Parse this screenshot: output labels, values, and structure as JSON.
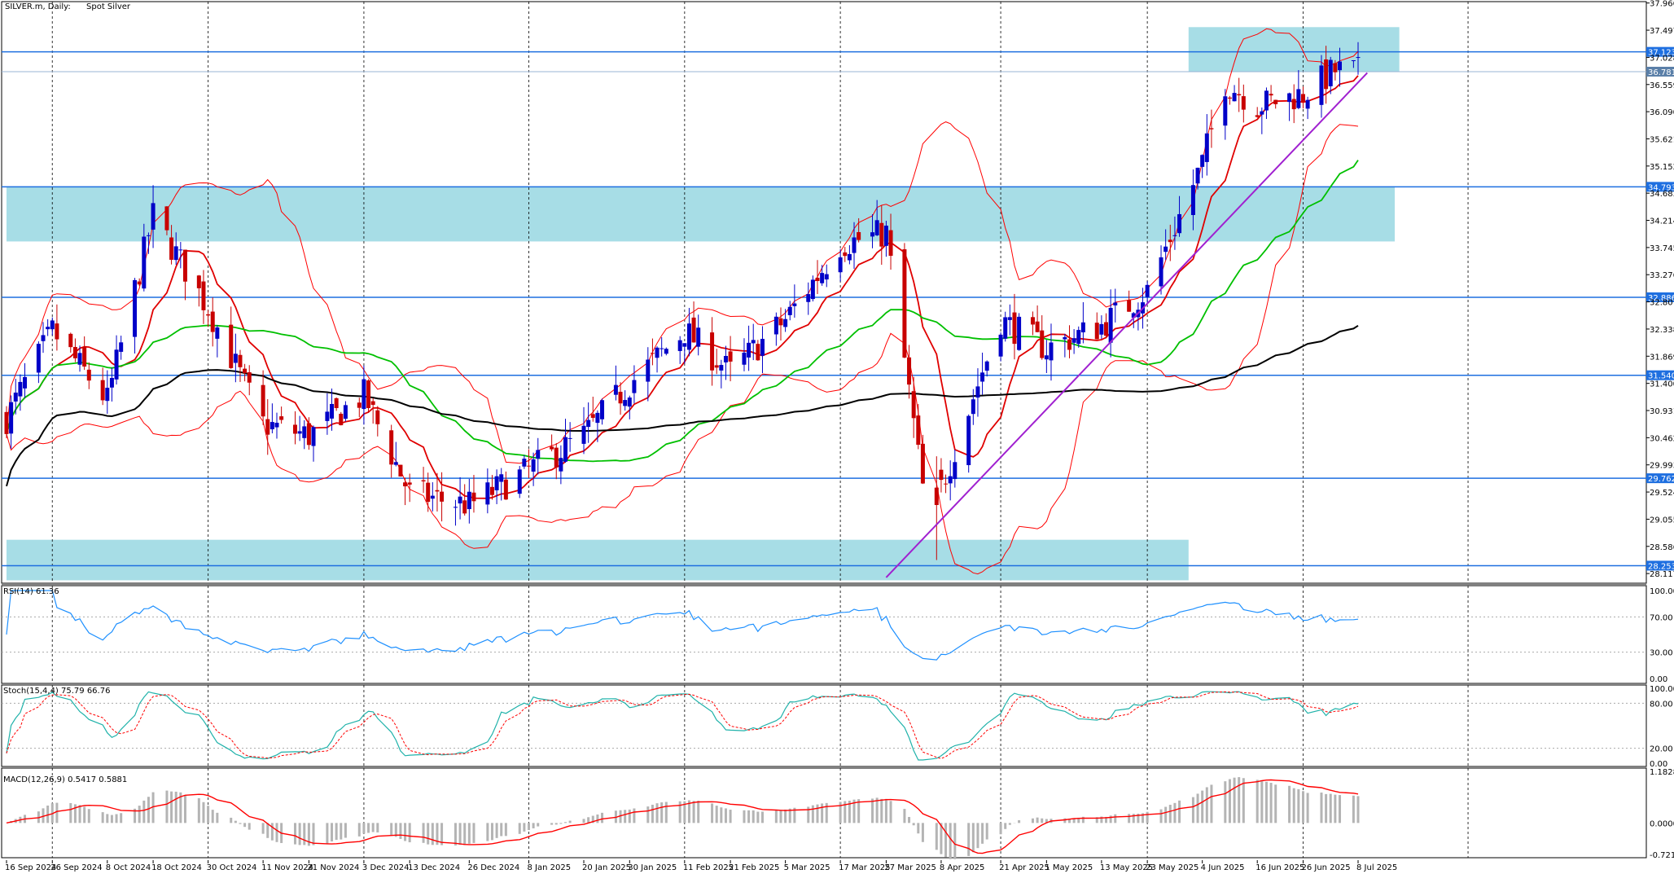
{
  "header": {
    "symbol": "SILVER.m, Daily:",
    "description": "Spot Silver"
  },
  "panels": {
    "rsi_title": "RSI(14) 61.36",
    "stoch_title": "Stoch(15,4,4) 75.79 66.76",
    "macd_title": "MACD(12,26,9) 0.5417 0.5881"
  },
  "colors": {
    "up_candle": "#0000c8",
    "down_candle": "#c80000",
    "zone_fill": "#a7dde6",
    "level_line": "#1e6fe0",
    "ma_fast": "#e00000",
    "ma_mid": "#00c000",
    "ma_slow": "#000000",
    "bollinger": "#ff0000",
    "trendline": "#a020d0",
    "rsi_line": "#1e90ff",
    "stoch_main": "#20b2aa",
    "stoch_signal": "#ff0000",
    "macd_hist": "#b4b4b4",
    "macd_signal": "#ff0000"
  },
  "chart_data": {
    "type": "candlestick",
    "price_axis": {
      "ticks": [
        "37.966",
        "37.497",
        "37.028",
        "36.559",
        "36.090",
        "35.621",
        "35.152",
        "34.683",
        "34.214",
        "33.745",
        "33.276",
        "32.807",
        "32.338",
        "31.869",
        "31.400",
        "30.931",
        "30.462",
        "29.993",
        "29.524",
        "29.055",
        "28.586",
        "28.117"
      ],
      "range": [
        27.95,
        37.99
      ]
    },
    "level_labels": [
      {
        "value": 37.123,
        "label": "37.123"
      },
      {
        "value": 36.781,
        "label": "36.781"
      },
      {
        "value": 34.793,
        "label": "34.793"
      },
      {
        "value": 32.886,
        "label": "32.886"
      },
      {
        "value": 31.54,
        "label": "31.540"
      },
      {
        "value": 29.762,
        "label": "29.762"
      },
      {
        "value": 28.253,
        "label": "28.253"
      }
    ],
    "zones": [
      {
        "from_date": "2025-06-01",
        "to_date": "2025-07-17",
        "low": 36.78,
        "high": 37.55
      },
      {
        "from_date": "2024-09-16",
        "to_date": "2025-07-16",
        "low": 33.85,
        "high": 34.8
      },
      {
        "from_date": "2024-09-16",
        "to_date": "2025-06-01",
        "low": 28.0,
        "high": 28.7
      }
    ],
    "trendline": {
      "from": [
        "2025-03-27",
        28.05
      ],
      "to": [
        "2025-07-10",
        36.76
      ]
    },
    "time_axis": [
      "16 Sep 2024",
      "26 Sep 2024",
      "8 Oct 2024",
      "18 Oct 2024",
      "30 Oct 2024",
      "11 Nov 2024",
      "21 Nov 2024",
      "3 Dec 2024",
      "13 Dec 2024",
      "26 Dec 2024",
      "8 Jan 2025",
      "20 Jan 2025",
      "30 Jan 2025",
      "11 Feb 2025",
      "21 Feb 2025",
      "5 Mar 2025",
      "17 Mar 2025",
      "27 Mar 2025",
      "8 Apr 2025",
      "21 Apr 2025",
      "1 May 2025",
      "13 May 2025",
      "23 May 2025",
      "4 Jun 2025",
      "16 Jun 2025",
      "26 Jun 2025",
      "8 Jul 2025"
    ],
    "closes_anchor": [
      [
        "2024-09-16",
        30.8
      ],
      [
        "2024-09-26",
        32.3
      ],
      [
        "2024-10-08",
        31.1
      ],
      [
        "2024-10-18",
        34.3
      ],
      [
        "2024-10-30",
        32.7
      ],
      [
        "2024-11-11",
        30.7
      ],
      [
        "2024-11-21",
        30.5
      ],
      [
        "2024-12-03",
        31.2
      ],
      [
        "2024-12-13",
        29.5
      ],
      [
        "2024-12-26",
        29.3
      ],
      [
        "2025-01-08",
        29.9
      ],
      [
        "2025-01-20",
        30.5
      ],
      [
        "2025-01-30",
        31.4
      ],
      [
        "2025-02-11",
        32.3
      ],
      [
        "2025-02-21",
        31.6
      ],
      [
        "2025-03-05",
        32.5
      ],
      [
        "2025-03-17",
        33.8
      ],
      [
        "2025-03-27",
        34.0
      ],
      [
        "2025-04-04",
        29.6
      ],
      [
        "2025-04-08",
        29.6
      ],
      [
        "2025-04-21",
        32.5
      ],
      [
        "2025-05-01",
        32.0
      ],
      [
        "2025-05-13",
        32.4
      ],
      [
        "2025-05-23",
        33.0
      ],
      [
        "2025-06-04",
        35.2
      ],
      [
        "2025-06-09",
        36.6
      ],
      [
        "2025-06-16",
        36.2
      ],
      [
        "2025-06-26",
        36.4
      ],
      [
        "2025-07-03",
        36.8
      ],
      [
        "2025-07-08",
        36.78
      ]
    ],
    "indicators": {
      "rsi": {
        "period": 14,
        "last": 61.36,
        "levels": [
          30,
          70
        ],
        "axis": [
          "100.00",
          "70.00",
          "30.00",
          "0.00"
        ]
      },
      "stochastic": {
        "params": "15,4,4",
        "main": 75.79,
        "signal": 66.76,
        "levels": [
          20,
          80
        ],
        "axis": [
          "100.00",
          "80.00",
          "20.00",
          "0.00"
        ]
      },
      "macd": {
        "params": "12,26,9",
        "main": 0.5417,
        "signal": 0.5881,
        "axis": [
          "1.1828",
          "0.0000",
          "-0.7218"
        ]
      }
    }
  }
}
